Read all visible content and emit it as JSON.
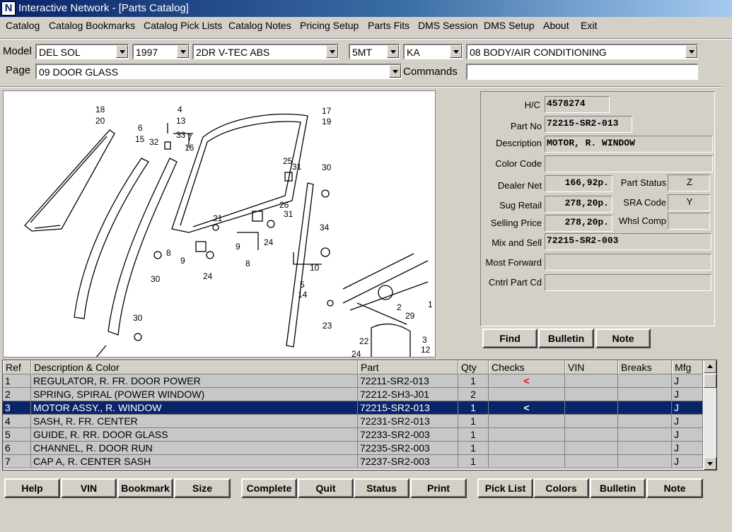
{
  "window": {
    "title": "Interactive Network - [Parts Catalog]",
    "icon": "app-logo-icon"
  },
  "menu": [
    "Catalog",
    "Catalog Bookmarks",
    "Catalog Pick Lists",
    "Catalog Notes",
    "Pricing Setup",
    "Parts Fits",
    "DMS Session",
    "DMS Setup",
    "About",
    "Exit"
  ],
  "selectors": {
    "model_label": "Model",
    "model": "DEL SOL",
    "year": "1997",
    "body": "2DR V-TEC ABS",
    "transmission": "5MT",
    "area": "KA",
    "section": "08  BODY/AIR CONDITIONING",
    "page_label": "Page",
    "page": "09  DOOR GLASS",
    "commands_label": "Commands",
    "commands_value": ""
  },
  "diagram": {
    "callouts": [
      "18",
      "20",
      "6",
      "15",
      "4",
      "13",
      "33",
      "7",
      "16",
      "32",
      "17",
      "19",
      "25",
      "31",
      "30",
      "26",
      "31",
      "21",
      "9",
      "24",
      "34",
      "8",
      "9",
      "8",
      "30",
      "24",
      "10",
      "5",
      "14",
      "1",
      "2",
      "29",
      "30",
      "23",
      "22",
      "3",
      "12",
      "24"
    ]
  },
  "details": {
    "hc_label": "H/C",
    "hc": "4578274",
    "part_no_label": "Part No",
    "part_no": "72215-SR2-013",
    "description_label": "Description",
    "description": "MOTOR, R. WINDOW",
    "color_code_label": "Color Code",
    "color_code": "",
    "dealer_net_label": "Dealer Net",
    "dealer_net": "166,92p.",
    "part_status_label": "Part Status",
    "part_status": "Z",
    "sug_retail_label": "Sug Retail",
    "sug_retail": "278,20p.",
    "sra_code_label": "SRA Code",
    "sra_code": "Y",
    "selling_price_label": "Selling Price",
    "selling_price": "278,20p.",
    "whsl_comp_label": "Whsl Comp",
    "whsl_comp": "",
    "mix_sell_label": "Mix and Sell",
    "mix_sell": "72215-SR2-003",
    "most_forward_label": "Most Forward",
    "most_forward": "",
    "cntrl_part_label": "Cntrl Part Cd",
    "cntrl_part": ""
  },
  "detail_buttons": [
    "Find",
    "Bulletin",
    "Note"
  ],
  "grid": {
    "headers": [
      "Ref",
      "Description & Color",
      "Part",
      "Qty",
      "Checks",
      "VIN",
      "Breaks",
      "Mfg"
    ],
    "rows": [
      {
        "ref": "1",
        "desc": "REGULATOR, R. FR. DOOR POWER",
        "part": "72211-SR2-013",
        "qty": "1",
        "checks": "<",
        "vin": "",
        "breaks": "",
        "mfg": "J"
      },
      {
        "ref": "2",
        "desc": "SPRING, SPIRAL (POWER WINDOW)",
        "part": "72212-SH3-J01",
        "qty": "2",
        "checks": "",
        "vin": "",
        "breaks": "",
        "mfg": "J"
      },
      {
        "ref": "3",
        "desc": "MOTOR ASSY., R. WINDOW",
        "part": "72215-SR2-013",
        "qty": "1",
        "checks": "<",
        "vin": "",
        "breaks": "",
        "mfg": "J"
      },
      {
        "ref": "4",
        "desc": "SASH, R. FR. CENTER",
        "part": "72231-SR2-013",
        "qty": "1",
        "checks": "",
        "vin": "",
        "breaks": "",
        "mfg": "J"
      },
      {
        "ref": "5",
        "desc": "GUIDE, R. RR. DOOR GLASS",
        "part": "72233-SR2-003",
        "qty": "1",
        "checks": "",
        "vin": "",
        "breaks": "",
        "mfg": "J"
      },
      {
        "ref": "6",
        "desc": "CHANNEL, R. DOOR RUN",
        "part": "72235-SR2-003",
        "qty": "1",
        "checks": "",
        "vin": "",
        "breaks": "",
        "mfg": "J"
      },
      {
        "ref": "7",
        "desc": "CAP A, R. CENTER SASH",
        "part": "72237-SR2-003",
        "qty": "1",
        "checks": "",
        "vin": "",
        "breaks": "",
        "mfg": "J"
      }
    ],
    "selected_index": 2,
    "check_color": "#ff0000"
  },
  "bottom_buttons": [
    "Help",
    "VIN",
    "Bookmark",
    "Size",
    "Complete",
    "Quit",
    "Status",
    "Print",
    "Pick List",
    "Colors",
    "Bulletin",
    "Note"
  ],
  "colors": {
    "selection": "#0a246a",
    "title_start": "#0a246a",
    "title_end": "#a6caf0"
  }
}
